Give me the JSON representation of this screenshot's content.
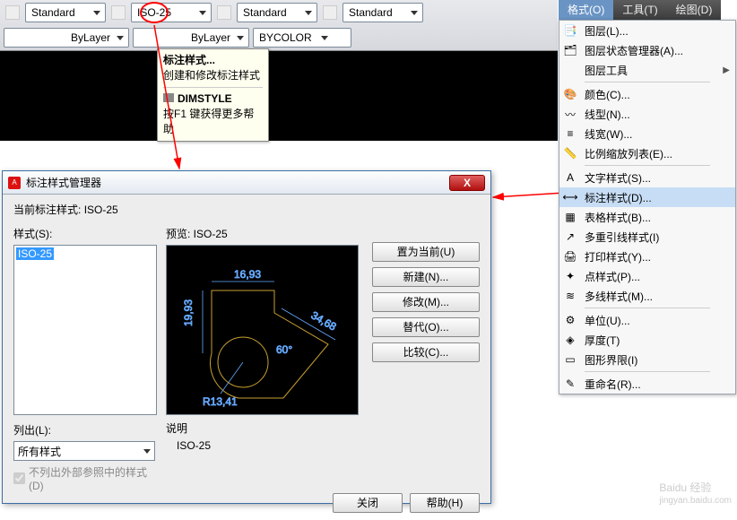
{
  "toolbar": {
    "row1": {
      "dd1": "Standard",
      "dd2": "ISO-25",
      "dd3": "Standard",
      "dd4": "Standard"
    },
    "row2": {
      "dd1": "ByLayer",
      "dd2": "ByLayer",
      "dd3": "BYCOLOR"
    }
  },
  "tooltip": {
    "title": "标注样式...",
    "sub": "创建和修改标注样式",
    "cmd": "DIMSTYLE",
    "help": "按F1 键获得更多帮助"
  },
  "dialog": {
    "title": "标注样式管理器",
    "current_lbl": "当前标注样式:",
    "current_val": "ISO-25",
    "styles_lbl": "样式(S):",
    "styles_sel": "ISO-25",
    "preview_lbl": "预览: ISO-25",
    "desc_lbl": "说明",
    "desc_val": "ISO-25",
    "list_lbl": "列出(L):",
    "list_val": "所有样式",
    "chk": "不列出外部参照中的样式(D)",
    "btns": {
      "current": "置为当前(U)",
      "new": "新建(N)...",
      "modify": "修改(M)...",
      "override": "替代(O)...",
      "compare": "比较(C)..."
    },
    "close": "关闭",
    "help": "帮助(H)",
    "dims": {
      "w": "16,93",
      "h": "19,93",
      "r": "R13,41",
      "ang": "60°",
      "d": "34,68"
    }
  },
  "menubar": {
    "format": "格式(O)",
    "tools": "工具(T)",
    "draw": "绘图(D)"
  },
  "menu": {
    "layer": "图层(L)...",
    "layerstate": "图层状态管理器(A)...",
    "layertools": "图层工具",
    "color": "颜色(C)...",
    "linetype": "线型(N)...",
    "lineweight": "线宽(W)...",
    "scalelist": "比例缩放列表(E)...",
    "textstyle": "文字样式(S)...",
    "dimstyle": "标注样式(D)...",
    "tablestyle": "表格样式(B)...",
    "mleaderstyle": "多重引线样式(I)",
    "plotstyle": "打印样式(Y)...",
    "pointstyle": "点样式(P)...",
    "mlinestyle": "多线样式(M)...",
    "units": "单位(U)...",
    "thickness": "厚度(T)",
    "limits": "图形界限(I)",
    "rename": "重命名(R)..."
  },
  "watermark": {
    "brand": "Baidu 经验",
    "url": "jingyan.baidu.com"
  }
}
